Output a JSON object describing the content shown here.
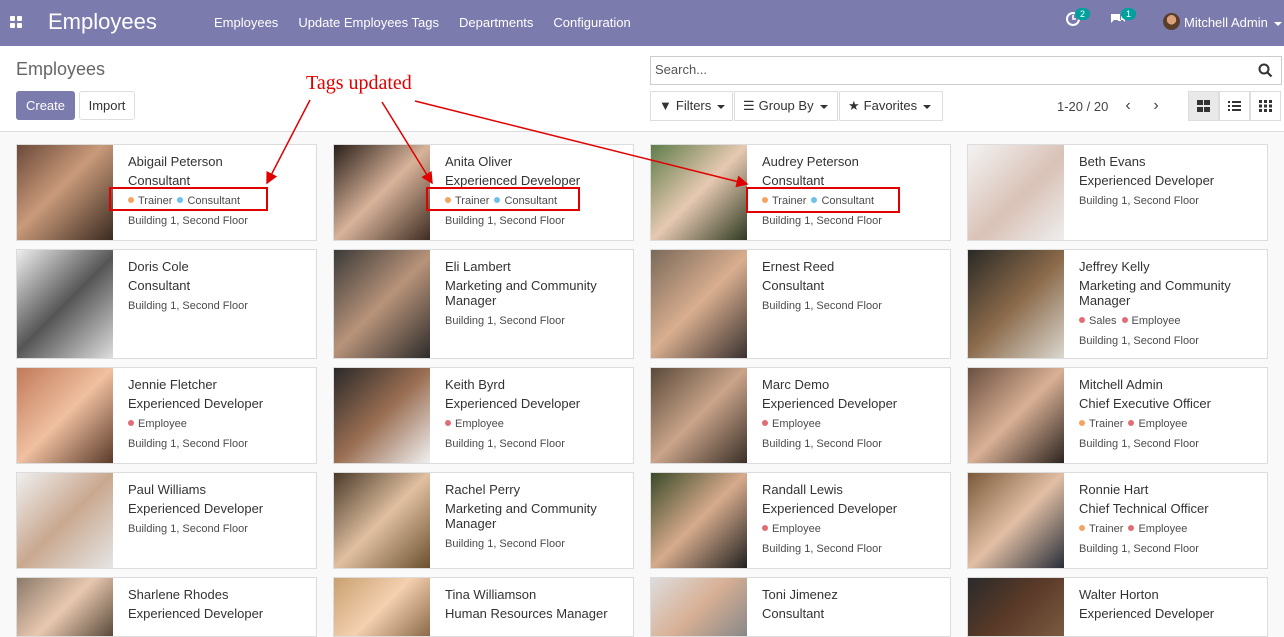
{
  "topbar": {
    "app_title": "Employees",
    "menu": [
      "Employees",
      "Update Employees Tags",
      "Departments",
      "Configuration"
    ],
    "activity_count": "2",
    "messages_count": "1",
    "user_name": "Mitchell Admin"
  },
  "control": {
    "breadcrumb": "Employees",
    "create_label": "Create",
    "import_label": "Import",
    "search_placeholder": "Search...",
    "filters_label": "Filters",
    "groupby_label": "Group By",
    "favorites_label": "Favorites",
    "pager": "1-20 / 20"
  },
  "annotation": {
    "text": "Tags updated"
  },
  "colors": {
    "brand": "#7c7bad",
    "tag_trainer": "#f4a460",
    "tag_consultant": "#6cc1ed",
    "tag_employee": "#e06c75",
    "tag_sales": "#e06c75",
    "annotation": "#e00000"
  },
  "employees": [
    {
      "name": "Abigail Peterson",
      "job": "Consultant",
      "tags": [
        {
          "label": "Trainer",
          "color": "#f4a460"
        },
        {
          "label": "Consultant",
          "color": "#6cc1ed"
        }
      ],
      "location": "Building 1, Second Floor"
    },
    {
      "name": "Anita Oliver",
      "job": "Experienced Developer",
      "tags": [
        {
          "label": "Trainer",
          "color": "#f4a460"
        },
        {
          "label": "Consultant",
          "color": "#6cc1ed"
        }
      ],
      "location": "Building 1, Second Floor"
    },
    {
      "name": "Audrey Peterson",
      "job": "Consultant",
      "tags": [
        {
          "label": "Trainer",
          "color": "#f4a460"
        },
        {
          "label": "Consultant",
          "color": "#6cc1ed"
        }
      ],
      "location": "Building 1, Second Floor"
    },
    {
      "name": "Beth Evans",
      "job": "Experienced Developer",
      "tags": [],
      "location": "Building 1, Second Floor"
    },
    {
      "name": "Doris Cole",
      "job": "Consultant",
      "tags": [],
      "location": "Building 1, Second Floor"
    },
    {
      "name": "Eli Lambert",
      "job": "Marketing and Community Manager",
      "tags": [],
      "location": "Building 1, Second Floor"
    },
    {
      "name": "Ernest Reed",
      "job": "Consultant",
      "tags": [],
      "location": "Building 1, Second Floor"
    },
    {
      "name": "Jeffrey Kelly",
      "job": "Marketing and Community Manager",
      "tags": [
        {
          "label": "Sales",
          "color": "#e06c75"
        },
        {
          "label": "Employee",
          "color": "#e06c75"
        }
      ],
      "location": "Building 1, Second Floor"
    },
    {
      "name": "Jennie Fletcher",
      "job": "Experienced Developer",
      "tags": [
        {
          "label": "Employee",
          "color": "#e06c75"
        }
      ],
      "location": "Building 1, Second Floor"
    },
    {
      "name": "Keith Byrd",
      "job": "Experienced Developer",
      "tags": [
        {
          "label": "Employee",
          "color": "#e06c75"
        }
      ],
      "location": "Building 1, Second Floor"
    },
    {
      "name": "Marc Demo",
      "job": "Experienced Developer",
      "tags": [
        {
          "label": "Employee",
          "color": "#e06c75"
        }
      ],
      "location": "Building 1, Second Floor"
    },
    {
      "name": "Mitchell Admin",
      "job": "Chief Executive Officer",
      "tags": [
        {
          "label": "Trainer",
          "color": "#f4a460"
        },
        {
          "label": "Employee",
          "color": "#e06c75"
        }
      ],
      "location": "Building 1, Second Floor"
    },
    {
      "name": "Paul Williams",
      "job": "Experienced Developer",
      "tags": [],
      "location": "Building 1, Second Floor"
    },
    {
      "name": "Rachel Perry",
      "job": "Marketing and Community Manager",
      "tags": [],
      "location": "Building 1, Second Floor"
    },
    {
      "name": "Randall Lewis",
      "job": "Experienced Developer",
      "tags": [
        {
          "label": "Employee",
          "color": "#e06c75"
        }
      ],
      "location": "Building 1, Second Floor"
    },
    {
      "name": "Ronnie Hart",
      "job": "Chief Technical Officer",
      "tags": [
        {
          "label": "Trainer",
          "color": "#f4a460"
        },
        {
          "label": "Employee",
          "color": "#e06c75"
        }
      ],
      "location": "Building 1, Second Floor"
    },
    {
      "name": "Sharlene Rhodes",
      "job": "Experienced Developer",
      "tags": [],
      "location": ""
    },
    {
      "name": "Tina Williamson",
      "job": "Human Resources Manager",
      "tags": [],
      "location": ""
    },
    {
      "name": "Toni Jimenez",
      "job": "Consultant",
      "tags": [],
      "location": ""
    },
    {
      "name": "Walter Horton",
      "job": "Experienced Developer",
      "tags": [],
      "location": ""
    }
  ]
}
